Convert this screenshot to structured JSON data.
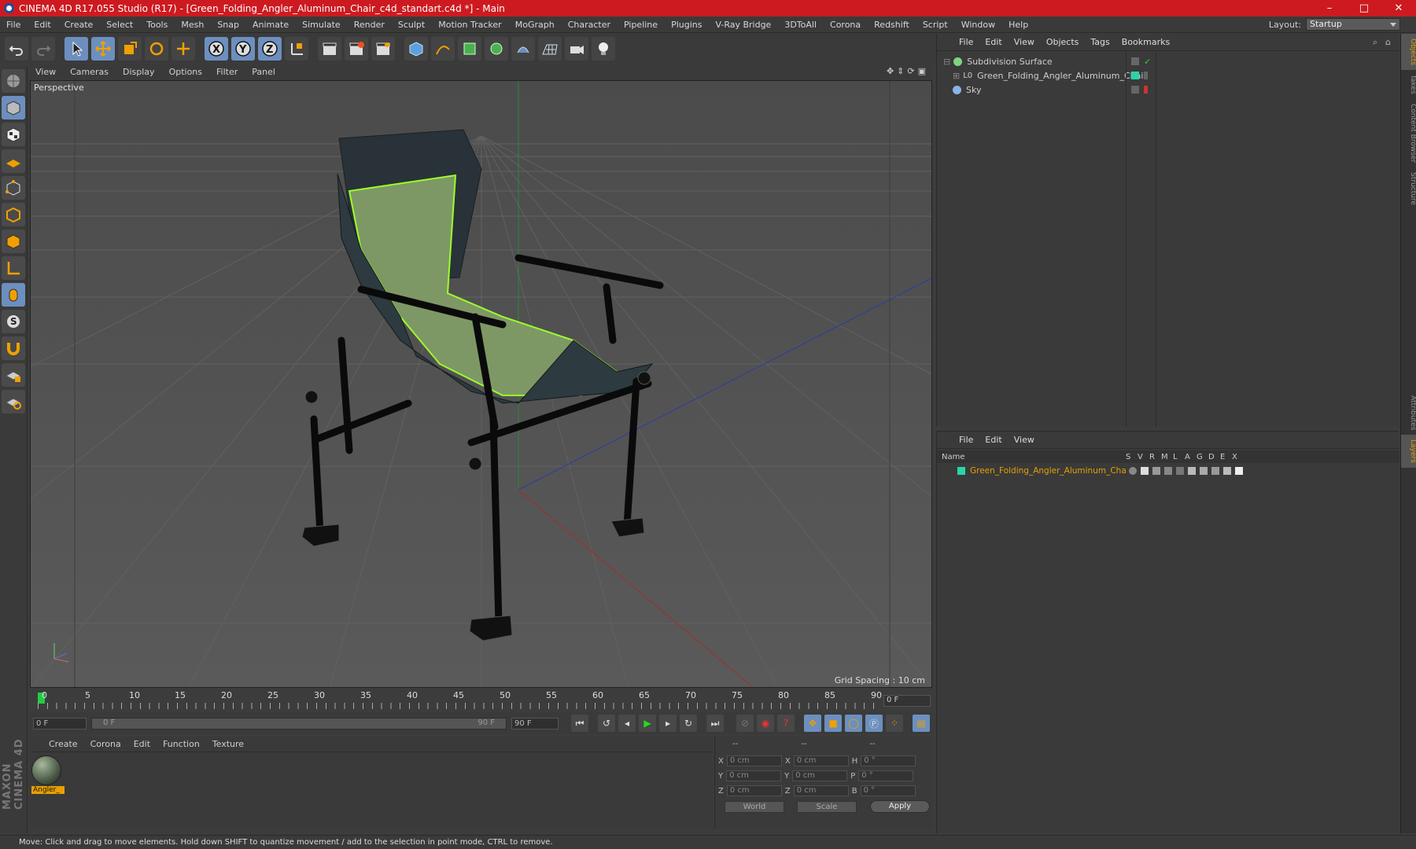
{
  "window": {
    "title": "CINEMA 4D R17.055 Studio (R17) - [Green_Folding_Angler_Aluminum_Chair_c4d_standart.c4d *] - Main",
    "minimize": "–",
    "maximize": "□",
    "close": "✕"
  },
  "menubar": [
    "File",
    "Edit",
    "Create",
    "Select",
    "Tools",
    "Mesh",
    "Snap",
    "Animate",
    "Simulate",
    "Render",
    "Sculpt",
    "Motion Tracker",
    "MoGraph",
    "Character",
    "Pipeline",
    "Plugins",
    "V-Ray Bridge",
    "3DToAll",
    "Corona",
    "Redshift",
    "Script",
    "Window",
    "Help"
  ],
  "layout": {
    "label": "Layout:",
    "value": "Startup"
  },
  "viewport": {
    "menu": [
      "View",
      "Cameras",
      "Display",
      "Options",
      "Filter",
      "Panel"
    ],
    "label": "Perspective",
    "grid_spacing": "Grid Spacing : 10 cm"
  },
  "timeline": {
    "ticks": [
      "0",
      "5",
      "10",
      "15",
      "20",
      "25",
      "30",
      "35",
      "40",
      "45",
      "50",
      "55",
      "60",
      "65",
      "70",
      "75",
      "80",
      "85",
      "90"
    ],
    "current_frame": "0 F"
  },
  "transport": {
    "start": "0 F",
    "range_start": "0 F",
    "range_end": "90 F",
    "end": "90 F"
  },
  "material_panel": {
    "menu": [
      "Create",
      "Corona",
      "Edit",
      "Function",
      "Texture"
    ],
    "material_name": "Angler_"
  },
  "coord_panel": {
    "headers": [
      "--",
      "--",
      "--"
    ],
    "rows": [
      {
        "a": "X",
        "av": "0 cm",
        "b": "X",
        "bv": "0 cm",
        "c": "H",
        "cv": "0 °"
      },
      {
        "a": "Y",
        "av": "0 cm",
        "b": "Y",
        "bv": "0 cm",
        "c": "P",
        "cv": "0 °"
      },
      {
        "a": "Z",
        "av": "0 cm",
        "b": "Z",
        "bv": "0 cm",
        "c": "B",
        "cv": "0 °"
      }
    ],
    "world": "World",
    "scale": "Scale",
    "apply": "Apply"
  },
  "object_panel": {
    "menu": [
      "File",
      "Edit",
      "View",
      "Objects",
      "Tags",
      "Bookmarks"
    ],
    "objects": [
      {
        "name": "Subdivision Surface",
        "color": "#7fd47f"
      },
      {
        "name": "Green_Folding_Angler_Aluminum_Chair",
        "color": "#cccccc"
      },
      {
        "name": "Sky",
        "color": "#8ab4e8"
      }
    ]
  },
  "attr_panel": {
    "menu": [
      "File",
      "Edit",
      "View"
    ],
    "columns": [
      "Name",
      "S",
      "V",
      "R",
      "M",
      "L",
      "A",
      "G",
      "D",
      "E",
      "X"
    ],
    "row_name": "Green_Folding_Angler_Aluminum_Chair"
  },
  "right_tabs": [
    "Objects",
    "Takes",
    "Content Browser",
    "Structure",
    "Attributes",
    "Layers"
  ],
  "status": "Move: Click and drag to move elements. Hold down SHIFT to quantize movement / add to the selection in point mode, CTRL to remove.",
  "logo": "MAXON CINEMA 4D",
  "colors": {
    "accent": "#e8a000",
    "title_bar": "#cd1a20",
    "active_tool": "#6c8fbf"
  }
}
